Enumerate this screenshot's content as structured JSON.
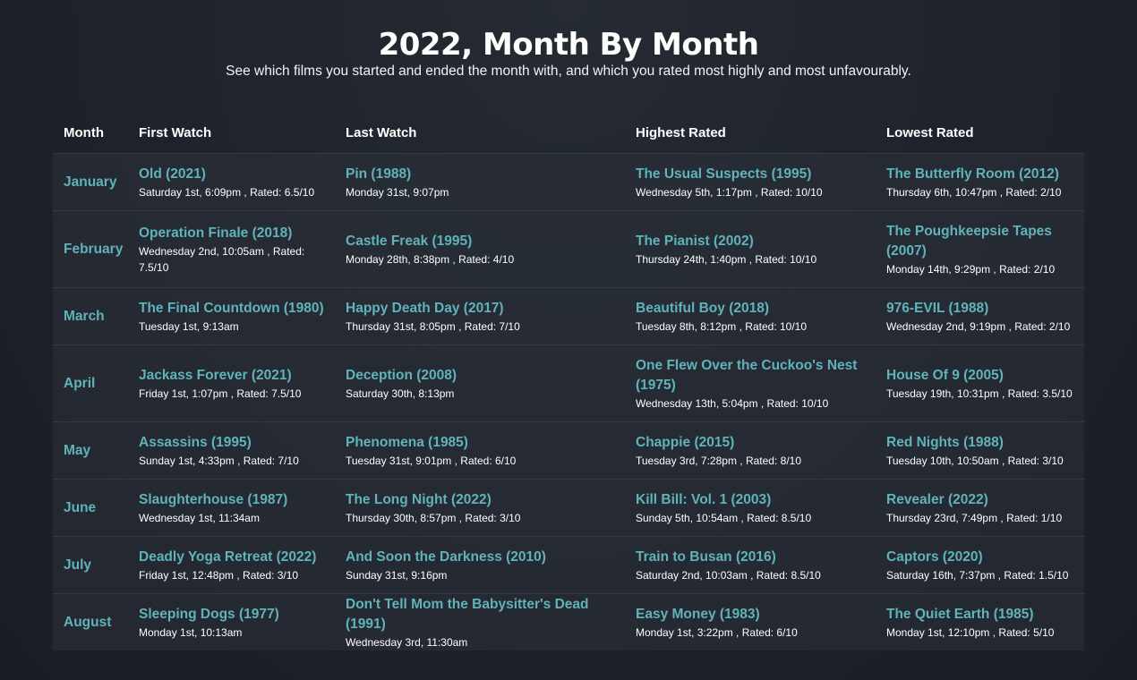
{
  "header": {
    "title": "2022, Month By Month",
    "subtitle": "See which films you started and ended the month with, and which you rated most highly and most unfavourably."
  },
  "columns": [
    "Month",
    "First Watch",
    "Last Watch",
    "Highest Rated",
    "Lowest Rated"
  ],
  "rows": [
    {
      "month": "January",
      "first": {
        "film": "Old (2021)",
        "meta": "Saturday 1st, 6:09pm , Rated: 6.5/10"
      },
      "last": {
        "film": "Pin (1988)",
        "meta": "Monday 31st, 9:07pm"
      },
      "highest": {
        "film": "The Usual Suspects (1995)",
        "meta": "Wednesday 5th, 1:17pm , Rated: 10/10"
      },
      "lowest": {
        "film": "The Butterfly Room (2012)",
        "meta": "Thursday 6th, 10:47pm , Rated: 2/10"
      }
    },
    {
      "month": "February",
      "first": {
        "film": "Operation Finale (2018)",
        "meta": "Wednesday 2nd, 10:05am , Rated: 7.5/10"
      },
      "last": {
        "film": "Castle Freak (1995)",
        "meta": "Monday 28th, 8:38pm , Rated: 4/10"
      },
      "highest": {
        "film": "The Pianist (2002)",
        "meta": "Thursday 24th, 1:40pm , Rated: 10/10"
      },
      "lowest": {
        "film": "The Poughkeepsie Tapes (2007)",
        "meta": "Monday 14th, 9:29pm , Rated: 2/10"
      }
    },
    {
      "month": "March",
      "first": {
        "film": "The Final Countdown (1980)",
        "meta": "Tuesday 1st, 9:13am"
      },
      "last": {
        "film": "Happy Death Day (2017)",
        "meta": "Thursday 31st, 8:05pm , Rated: 7/10"
      },
      "highest": {
        "film": "Beautiful Boy (2018)",
        "meta": "Tuesday 8th, 8:12pm , Rated: 10/10"
      },
      "lowest": {
        "film": "976-EVIL (1988)",
        "meta": "Wednesday 2nd, 9:19pm , Rated: 2/10"
      }
    },
    {
      "month": "April",
      "first": {
        "film": "Jackass Forever (2021)",
        "meta": "Friday 1st, 1:07pm , Rated: 7.5/10"
      },
      "last": {
        "film": "Deception (2008)",
        "meta": "Saturday 30th, 8:13pm"
      },
      "highest": {
        "film": "One Flew Over the Cuckoo's Nest (1975)",
        "meta": "Wednesday 13th, 5:04pm , Rated: 10/10"
      },
      "lowest": {
        "film": "House Of 9 (2005)",
        "meta": "Tuesday 19th, 10:31pm , Rated: 3.5/10"
      }
    },
    {
      "month": "May",
      "first": {
        "film": "Assassins (1995)",
        "meta": "Sunday 1st, 4:33pm , Rated: 7/10"
      },
      "last": {
        "film": "Phenomena (1985)",
        "meta": "Tuesday 31st, 9:01pm , Rated: 6/10"
      },
      "highest": {
        "film": "Chappie (2015)",
        "meta": "Tuesday 3rd, 7:28pm , Rated: 8/10"
      },
      "lowest": {
        "film": "Red Nights (1988)",
        "meta": "Tuesday 10th, 10:50am , Rated: 3/10"
      }
    },
    {
      "month": "June",
      "first": {
        "film": "Slaughterhouse (1987)",
        "meta": "Wednesday 1st, 11:34am"
      },
      "last": {
        "film": "The Long Night (2022)",
        "meta": "Thursday 30th, 8:57pm , Rated: 3/10"
      },
      "highest": {
        "film": "Kill Bill: Vol. 1 (2003)",
        "meta": "Sunday 5th, 10:54am , Rated: 8.5/10"
      },
      "lowest": {
        "film": "Revealer (2022)",
        "meta": "Thursday 23rd, 7:49pm , Rated: 1/10"
      }
    },
    {
      "month": "July",
      "first": {
        "film": "Deadly Yoga Retreat (2022)",
        "meta": "Friday 1st, 12:48pm , Rated: 3/10"
      },
      "last": {
        "film": "And Soon the Darkness (2010)",
        "meta": "Sunday 31st, 9:16pm"
      },
      "highest": {
        "film": "Train to Busan (2016)",
        "meta": "Saturday 2nd, 10:03am , Rated: 8.5/10"
      },
      "lowest": {
        "film": "Captors (2020)",
        "meta": "Saturday 16th, 7:37pm , Rated: 1.5/10"
      }
    },
    {
      "month": "August",
      "first": {
        "film": "Sleeping Dogs (1977)",
        "meta": "Monday 1st, 10:13am"
      },
      "last": {
        "film": "Don't Tell Mom the Babysitter's Dead (1991)",
        "meta": "Wednesday 3rd, 11:30am"
      },
      "highest": {
        "film": "Easy Money (1983)",
        "meta": "Monday 1st, 3:22pm , Rated: 6/10"
      },
      "lowest": {
        "film": "The Quiet Earth (1985)",
        "meta": "Monday 1st, 12:10pm , Rated: 5/10"
      }
    }
  ],
  "colors": {
    "accent": "#5fb3b9",
    "background": "#1e222a",
    "row_background": "#262b33"
  }
}
